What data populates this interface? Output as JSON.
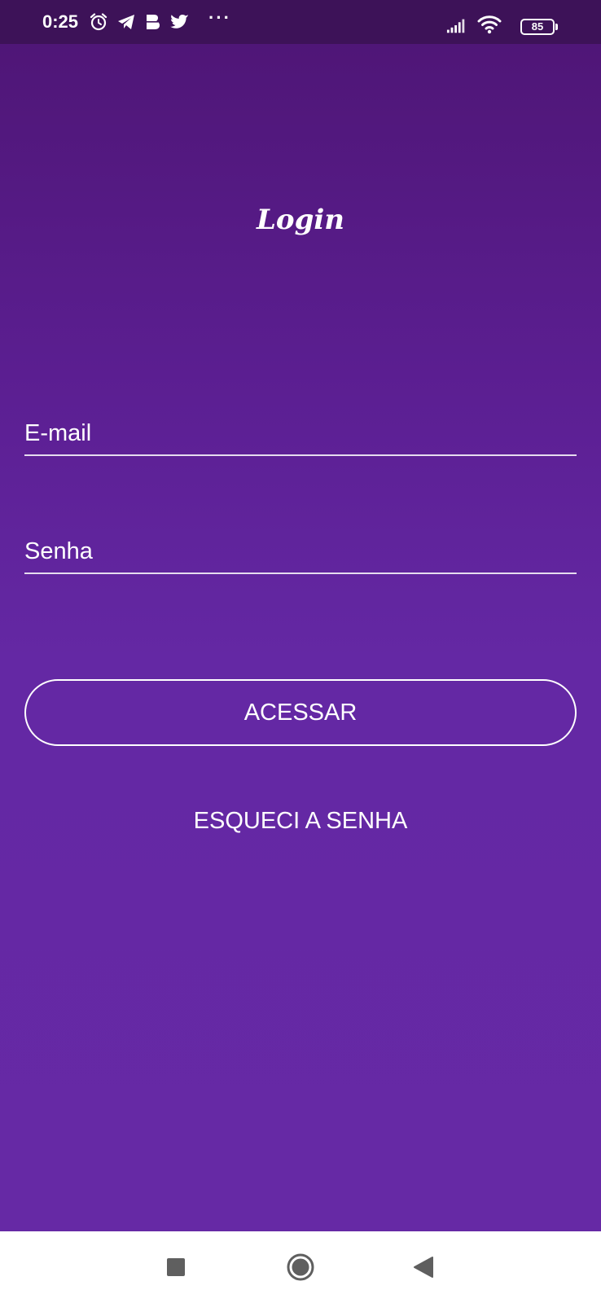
{
  "status_bar": {
    "time": "0:25",
    "icons": [
      "alarm-icon",
      "telegram-icon",
      "b-app-icon",
      "twitter-icon",
      "more-notifications-icon"
    ],
    "overflow": "···",
    "signal": "signal-icon",
    "wifi": "wifi-icon",
    "battery_level": "85"
  },
  "login": {
    "title": "Login",
    "email_placeholder": "E-mail",
    "email_value": "",
    "password_placeholder": "Senha",
    "password_value": "",
    "submit_label": "ACESSAR",
    "forgot_label": "ESQUECI A SENHA"
  },
  "nav_bar": {
    "buttons": [
      "recents-square-icon",
      "home-circle-icon",
      "back-triangle-icon"
    ]
  },
  "colors": {
    "status_bar_bg": "#3d1258",
    "gradient_top": "#4f1677",
    "gradient_bottom": "#6629a5",
    "foreground": "#ffffff",
    "nav_bar_bg": "#ffffff",
    "nav_icon": "#5f5f5f"
  }
}
